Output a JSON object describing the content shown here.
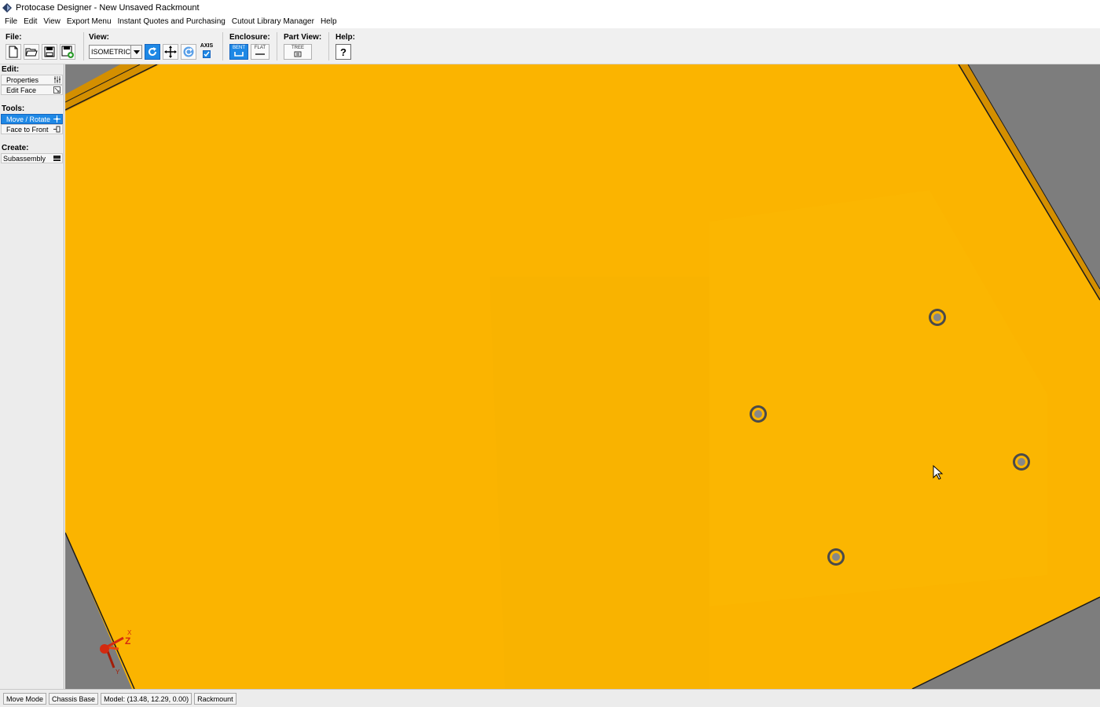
{
  "window": {
    "title": "Protocase Designer - New Unsaved Rackmount"
  },
  "menu": [
    "File",
    "Edit",
    "View",
    "Export Menu",
    "Instant Quotes and Purchasing",
    "Cutout Library Manager",
    "Help"
  ],
  "toolbar": {
    "file_label": "File:",
    "view_label": "View:",
    "view_select_value": "ISOMETRIC",
    "axis_label": "AXIS",
    "enclosure_label": "Enclosure:",
    "bent_label": "BENT",
    "flat_label": "FLAT",
    "part_view_label": "Part View:",
    "tree_label": "TREE",
    "help_label": "Help:",
    "help_glyph": "?"
  },
  "sidebar": {
    "edit_label": "Edit:",
    "edit_items": [
      "Properties",
      "Edit Face"
    ],
    "tools_label": "Tools:",
    "tool_items": [
      "Move / Rotate",
      "Face to Front"
    ],
    "create_label": "Create:",
    "create_items": [
      "Subassembly"
    ]
  },
  "viewport": {
    "panel_color": "#fbb400",
    "background_color": "#7d7d7d",
    "axis_label_z": "Z",
    "axis_label_x": "X",
    "axis_label_y": "Y"
  },
  "status": [
    "Move Mode",
    "Chassis Base",
    "Model: (13.48, 12.29, 0.00)",
    "Rackmount"
  ]
}
